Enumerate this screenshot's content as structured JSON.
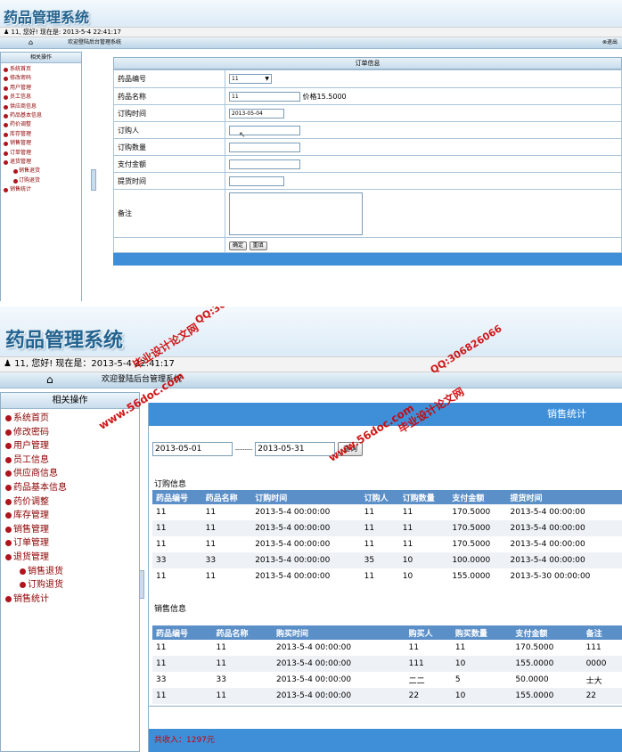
{
  "app": {
    "title": "药品管理系统"
  },
  "status": {
    "greeting_short": "11, 您好! 现在是: 2013-5-4 22:41:17",
    "greeting_long": "11, 您好! 现在是：2013-5-4 22:41:17"
  },
  "nav": {
    "welcome": "欢迎登陆后台管理系统",
    "logout": "退出"
  },
  "sidebar": {
    "header": "相关操作",
    "items": [
      {
        "label": "系统首页",
        "sub": false
      },
      {
        "label": "修改密码",
        "sub": false
      },
      {
        "label": "用户管理",
        "sub": false
      },
      {
        "label": "员工信息",
        "sub": false
      },
      {
        "label": "供应商信息",
        "sub": false
      },
      {
        "label": "药品基本信息",
        "sub": false
      },
      {
        "label": "药价调整",
        "sub": false
      },
      {
        "label": "库存管理",
        "sub": false
      },
      {
        "label": "销售管理",
        "sub": false
      },
      {
        "label": "订单管理",
        "sub": false
      },
      {
        "label": "退货管理",
        "sub": false
      },
      {
        "label": "销售退货",
        "sub": true
      },
      {
        "label": "订购退货",
        "sub": true
      },
      {
        "label": "销售统计",
        "sub": false
      }
    ]
  },
  "order_form": {
    "title": "订单信息",
    "fields": {
      "drug_id": {
        "label": "药品编号",
        "value": "11"
      },
      "drug_name": {
        "label": "药品名称",
        "value": "11",
        "price_text": "价格15.5000"
      },
      "order_time": {
        "label": "订购时间",
        "value": "2013-05-04"
      },
      "buyer": {
        "label": "订购人",
        "value": ""
      },
      "quantity": {
        "label": "订购数量",
        "value": ""
      },
      "amount": {
        "label": "支付金额",
        "value": ""
      },
      "pickup_time": {
        "label": "提货时间",
        "value": ""
      },
      "remark": {
        "label": "备注",
        "value": ""
      }
    },
    "buttons": {
      "submit": "确定",
      "reset": "重填"
    }
  },
  "sales_stats": {
    "title": "销售统计",
    "date_from": "2013-05-01",
    "date_sep": "---------",
    "date_to": "2013-05-31",
    "search_label": "查询",
    "order_section": {
      "label": "订购信息",
      "columns": [
        "药品编号",
        "药品名称",
        "订购时间",
        "订购人",
        "订购数量",
        "支付金额",
        "提货时间"
      ],
      "rows": [
        [
          "11",
          "11",
          "2013-5-4 00:00:00",
          "11",
          "11",
          "170.5000",
          "2013-5-4 00:00:00"
        ],
        [
          "11",
          "11",
          "2013-5-4 00:00:00",
          "11",
          "11",
          "170.5000",
          "2013-5-4 00:00:00"
        ],
        [
          "11",
          "11",
          "2013-5-4 00:00:00",
          "11",
          "11",
          "170.5000",
          "2013-5-4 00:00:00"
        ],
        [
          "33",
          "33",
          "2013-5-4 00:00:00",
          "35",
          "10",
          "100.0000",
          "2013-5-4 00:00:00"
        ],
        [
          "11",
          "11",
          "2013-5-4 00:00:00",
          "11",
          "10",
          "155.0000",
          "2013-5-30 00:00:00"
        ]
      ]
    },
    "sales_section": {
      "label": "销售信息",
      "columns": [
        "药品编号",
        "药品名称",
        "购买时间",
        "购买人",
        "购买数量",
        "支付金额",
        "备注"
      ],
      "rows": [
        [
          "11",
          "11",
          "2013-5-4 00:00:00",
          "11",
          "11",
          "170.5000",
          "111"
        ],
        [
          "11",
          "11",
          "2013-5-4 00:00:00",
          "111",
          "10",
          "155.0000",
          "0000"
        ],
        [
          "33",
          "33",
          "2013-5-4 00:00:00",
          "二二",
          "5",
          "50.0000",
          "士大"
        ],
        [
          "11",
          "11",
          "2013-5-4 00:00:00",
          "22",
          "10",
          "155.0000",
          "22"
        ]
      ]
    },
    "total_text": "共收入：1297元"
  },
  "watermarks": {
    "site": "www.56doc.com",
    "brand": "毕业设计论文网",
    "qq": "QQ:306826066"
  },
  "colors": {
    "accent_blue": "#3f8fd8",
    "menu_red": "#8b0000",
    "title_blue": "#23638f"
  }
}
